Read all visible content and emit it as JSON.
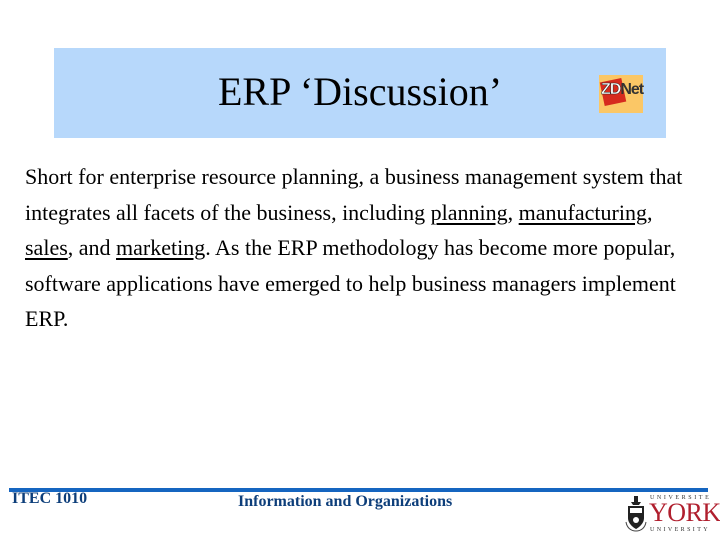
{
  "slide": {
    "title": "ERP ‘Discussion’",
    "title_box_color": "#b7d8fb",
    "logo": {
      "icon": "zdnet-logo",
      "zd": "ZD",
      "net": "Net"
    }
  },
  "body": {
    "segments": [
      {
        "text": "Short for enterprise resource planning, a business management system that integrates all facets of the business, including ",
        "link": false
      },
      {
        "text": "planning",
        "link": true
      },
      {
        "text": ", ",
        "link": false
      },
      {
        "text": "manufacturing",
        "link": true
      },
      {
        "text": ", ",
        "link": false
      },
      {
        "text": "sales",
        "link": true
      },
      {
        "text": ", and ",
        "link": false
      },
      {
        "text": "marketing",
        "link": true
      },
      {
        "text": ". As the ERP methodology has become more popular, software applications have emerged to help business managers implement ERP.",
        "link": false
      }
    ]
  },
  "footer": {
    "course": "ITEC 1010",
    "course_title": "Information and Organizations",
    "rule_color": "#1565c0",
    "text_color": "#0d3e7a",
    "logo": {
      "icon": "york-university-crest-icon",
      "top": "UNIVERSITE",
      "main": "YORK",
      "bottom": "UNIVERSITY"
    }
  }
}
